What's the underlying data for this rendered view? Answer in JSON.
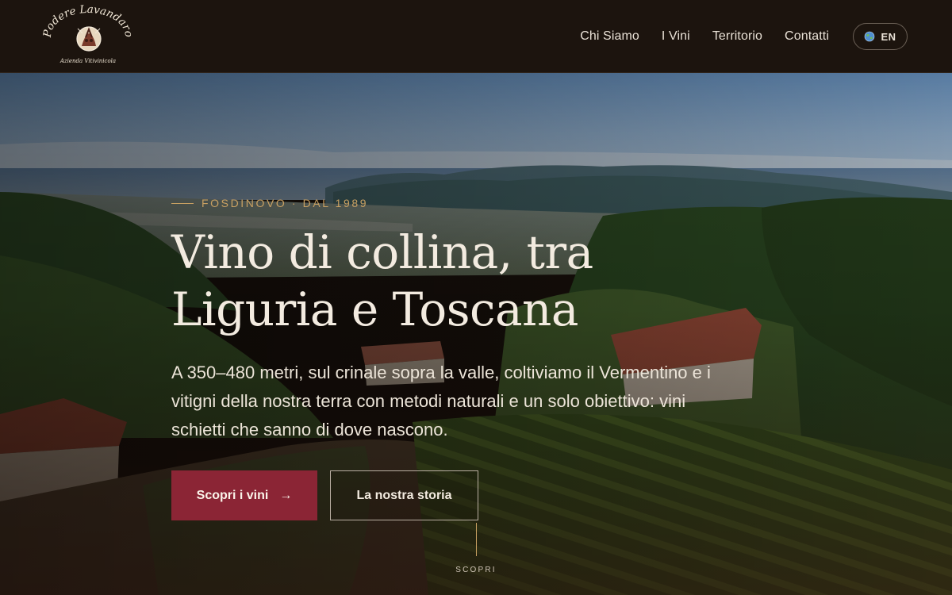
{
  "brand": {
    "name": "Podere Lavandaro",
    "tagline": "Azienda Vitivinicola"
  },
  "nav": {
    "items": [
      {
        "label": "Chi Siamo"
      },
      {
        "label": "I Vini"
      },
      {
        "label": "Territorio"
      },
      {
        "label": "Contatti"
      }
    ],
    "language_label": "EN",
    "language_icon": "globe-icon"
  },
  "hero": {
    "eyebrow": "FOSDINOVO · DAL 1989",
    "headline": "Vino di collina, tra Liguria e Toscana",
    "lede": "A 350–480 metri, sul crinale sopra la valle, coltiviamo il Vermentino e i vitigni della nostra terra con metodi naturali e un solo obiettivo: vini schietti che sanno di dove nascono.",
    "primary_cta": "Scopri i vini",
    "primary_cta_icon": "→",
    "secondary_cta": "La nostra storia",
    "scroll_label": "SCOPRI"
  },
  "colors": {
    "header_bg": "#1c140e",
    "accent_gold": "#c8a062",
    "primary_button": "#8b2535",
    "text_light": "#f3ebe0"
  }
}
